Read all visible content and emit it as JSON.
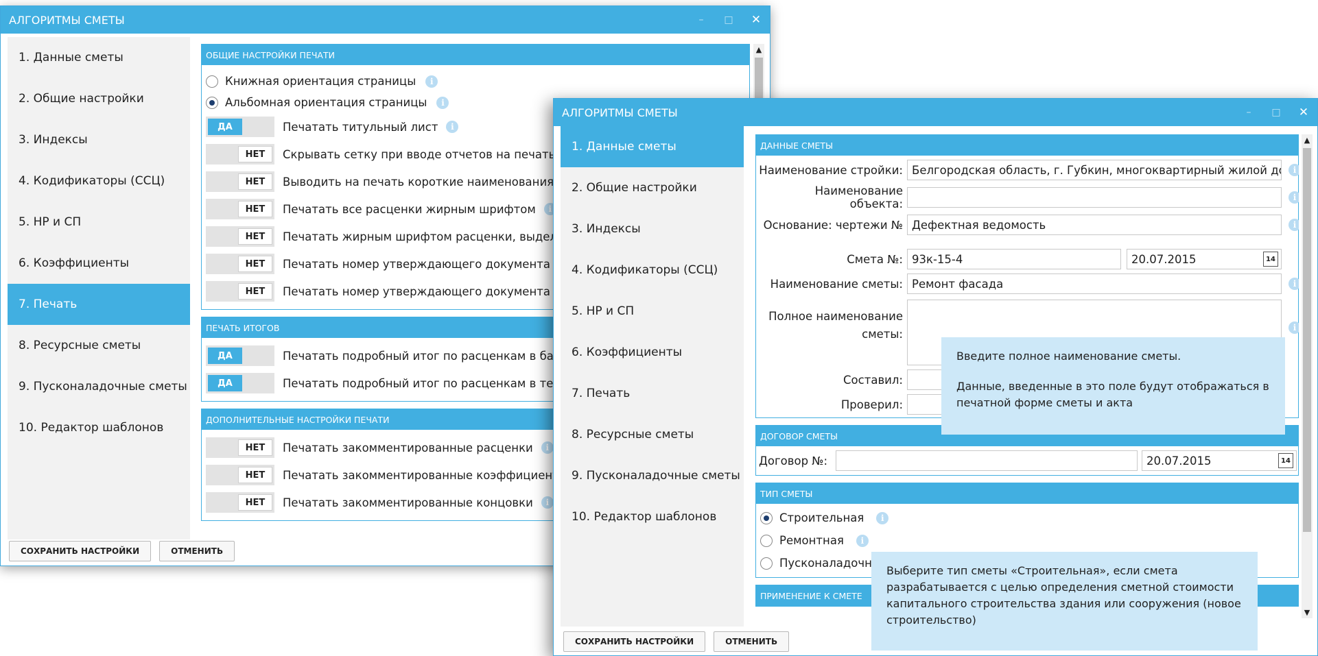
{
  "window1": {
    "title": "АЛГОРИТМЫ СМЕТЫ",
    "nav": [
      "1. Данные сметы",
      "2. Общие настройки",
      "3. Индексы",
      "4. Кодификаторы (ССЦ)",
      "5. НР и СП",
      "6. Коэффициенты",
      "7. Печать",
      "8. Ресурсные сметы",
      "9. Пусконаладочные сметы",
      "10. Редактор шаблонов"
    ],
    "active_nav": "7. Печать",
    "sec_print_general": "ОБЩИЕ НАСТРОЙКИ ПЕЧАТИ",
    "radio_portrait": "Книжная ориентация страницы",
    "radio_landscape": "Альбомная ориентация страницы",
    "selected_orientation": "Альбомная ориентация страницы",
    "toggles_general": [
      {
        "state": "ДА",
        "label": "Печатать титульный лист"
      },
      {
        "state": "НЕТ",
        "label": "Скрывать сетку при вводе отчетов на печать"
      },
      {
        "state": "НЕТ",
        "label": "Выводить на печать короткие наименования р"
      },
      {
        "state": "НЕТ",
        "label": "Печатать все расценки жирным шрифтом"
      },
      {
        "state": "НЕТ",
        "label": "Печатать жирным шрифтом расценки, выделе"
      },
      {
        "state": "НЕТ",
        "label": "Печатать номер утверждающего документа в п"
      },
      {
        "state": "НЕТ",
        "label": "Печатать номер утверждающего документа в п"
      }
    ],
    "sec_print_totals": "ПЕЧАТЬ ИТОГОВ",
    "toggles_totals": [
      {
        "state": "ДА",
        "label": "Печатать подробный итог по расценкам в базо"
      },
      {
        "state": "ДА",
        "label": "Печатать подробный итог по расценкам в теку"
      }
    ],
    "sec_print_extra": "ДОПОЛНИТЕЛЬНЫЕ НАСТРОЙКИ ПЕЧАТИ",
    "toggles_extra": [
      {
        "state": "НЕТ",
        "label": "Печатать закомментированные расценки"
      },
      {
        "state": "НЕТ",
        "label": "Печатать закомментированные коэффициенть"
      },
      {
        "state": "НЕТ",
        "label": "Печатать закомментированные концовки"
      }
    ],
    "save_label": "СОХРАНИТЬ НАСТРОЙКИ",
    "cancel_label": "ОТМЕНИТЬ"
  },
  "window2": {
    "title": "АЛГОРИТМЫ СМЕТЫ",
    "nav": [
      "1. Данные сметы",
      "2. Общие настройки",
      "3. Индексы",
      "4. Кодификаторы (ССЦ)",
      "5. НР и СП",
      "6. Коэффициенты",
      "7. Печать",
      "8. Ресурсные сметы",
      "9. Пусконаладочные сметы",
      "10. Редактор шаблонов"
    ],
    "active_nav": "1. Данные сметы",
    "sec_data": "ДАННЫЕ СМЕТЫ",
    "lbl_site": "Наименование стройки:",
    "val_site": "Белгородская область, г. Губкин, многоквартирный жилой дом",
    "lbl_object": "Наименование объекта:",
    "val_object": "",
    "lbl_basis": "Основание: чертежи №",
    "val_basis": "Дефектная ведомость",
    "lbl_estimate_no": "Смета №:",
    "val_estimate_no": "93к-15-4",
    "val_estimate_date": "20.07.2015",
    "lbl_estimate_name": "Наименование сметы:",
    "val_estimate_name": "Ремонт фасада",
    "lbl_full_name_1": "Полное наименование",
    "lbl_full_name_2": "сметы:",
    "lbl_compiled": "Составил:",
    "lbl_checked": "Проверил:",
    "calendar_day": "14",
    "sec_contract": "ДОГОВОР СМЕТЫ",
    "lbl_contract_no": "Договор №:",
    "val_contract_no": "",
    "val_contract_date": "20.07.2015",
    "sec_type": "ТИП СМЕТЫ",
    "type_options": [
      "Строительная",
      "Ремонтная",
      "Пусконаладочна"
    ],
    "selected_type": "Строительная",
    "sec_next_partial": "ПРИМЕНЕНИЕ К СМЕТЕ",
    "save_label": "СОХРАНИТЬ НАСТРОЙКИ",
    "cancel_label": "ОТМЕНИТЬ"
  },
  "tooltip_full_name": {
    "line1": "Введите полное наименование сметы.",
    "line2": "Данные, введенные в это поле будут отображаться в печатной форме сметы и акта"
  },
  "tooltip_type": {
    "text": "Выберите тип сметы «Строительная», если смета разрабатывается с целью определения сметной стоимости капитального строительства здания или сооружения (новое строительство)"
  },
  "icons": {
    "info": "i",
    "minimize": "–",
    "maximize": "□",
    "close": "✕",
    "scroll_up": "▲",
    "scroll_down": "▼"
  }
}
